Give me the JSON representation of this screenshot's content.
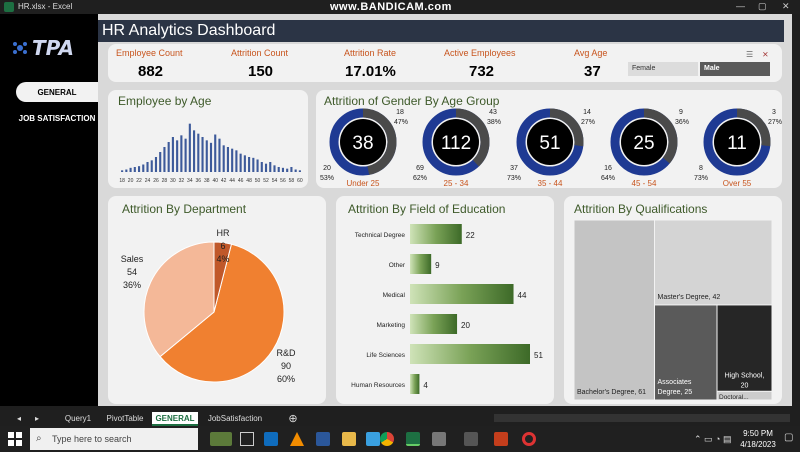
{
  "window": {
    "title": "HR.xlsx - Excel",
    "watermark": "www.BANDICAM.com"
  },
  "sidebar": {
    "logo": "TPA",
    "items": [
      {
        "label": "GENERAL"
      },
      {
        "label": "JOB SATISFACTION"
      }
    ]
  },
  "header": {
    "title": "HR Analytics Dashboard"
  },
  "kpis": [
    {
      "label": "Employee Count",
      "value": "882"
    },
    {
      "label": "Attrition Count",
      "value": "150"
    },
    {
      "label": "Attrition Rate",
      "value": "17.01%"
    },
    {
      "label": "Active Employees",
      "value": "732"
    },
    {
      "label": "Avg Age",
      "value": "37"
    }
  ],
  "gender_slicer": {
    "options": [
      "Female",
      "Male"
    ],
    "selected": "Male"
  },
  "charts": {
    "age_title": "Employee by Age",
    "gender_title": "Attrition of Gender By Age Group",
    "dept_title": "Attrition By Department",
    "edu_title": "Attrition By Field of Education",
    "qual_title": "Attrition By Qualifications"
  },
  "chart_data": [
    {
      "type": "bar",
      "title": "Employee by Age",
      "tick_labels": [
        "18",
        "20",
        "22",
        "24",
        "26",
        "28",
        "30",
        "32",
        "34",
        "36",
        "38",
        "40",
        "42",
        "44",
        "46",
        "48",
        "50",
        "52",
        "54",
        "56",
        "58",
        "60"
      ],
      "categories": [
        18,
        19,
        20,
        21,
        22,
        23,
        24,
        25,
        26,
        27,
        28,
        29,
        30,
        31,
        32,
        33,
        34,
        35,
        36,
        37,
        38,
        39,
        40,
        41,
        42,
        43,
        44,
        45,
        46,
        47,
        48,
        49,
        50,
        51,
        52,
        53,
        54,
        55,
        56,
        57,
        58,
        59,
        60
      ],
      "values": [
        2,
        3,
        5,
        6,
        7,
        9,
        12,
        14,
        18,
        24,
        30,
        36,
        42,
        38,
        44,
        40,
        58,
        50,
        46,
        42,
        38,
        35,
        45,
        40,
        32,
        30,
        28,
        26,
        22,
        20,
        18,
        17,
        15,
        12,
        10,
        12,
        8,
        6,
        5,
        4,
        6,
        3,
        2
      ],
      "ylim": [
        0,
        60
      ]
    },
    {
      "type": "pie",
      "title": "Attrition of Gender By Age Group",
      "groups": [
        {
          "label": "Under 25",
          "total": "38",
          "female_count": "18",
          "female_pct": "47%",
          "male_count": "20",
          "male_pct": "53%",
          "female_share": 0.47
        },
        {
          "label": "25 - 34",
          "total": "112",
          "female_count": "43",
          "female_pct": "38%",
          "male_count": "69",
          "male_pct": "62%",
          "female_share": 0.38
        },
        {
          "label": "35 - 44",
          "total": "51",
          "female_count": "14",
          "female_pct": "27%",
          "male_count": "37",
          "male_pct": "73%",
          "female_share": 0.27
        },
        {
          "label": "45 - 54",
          "total": "25",
          "female_count": "9",
          "female_pct": "36%",
          "male_count": "16",
          "male_pct": "64%",
          "female_share": 0.36
        },
        {
          "label": "Over 55",
          "total": "11",
          "female_count": "3",
          "female_pct": "27%",
          "male_count": "8",
          "male_pct": "73%",
          "female_share": 0.27
        }
      ]
    },
    {
      "type": "pie",
      "title": "Attrition By Department",
      "slices": [
        {
          "name": "R&D",
          "value": 90,
          "pct": "60%",
          "color": "#f08030"
        },
        {
          "name": "Sales",
          "value": 54,
          "pct": "36%",
          "color": "#f4b898"
        },
        {
          "name": "HR",
          "value": 6,
          "pct": "4%",
          "color": "#c0582a"
        }
      ]
    },
    {
      "type": "bar",
      "title": "Attrition By Field of Education",
      "categories": [
        "Technical Degree",
        "Other",
        "Medical",
        "Marketing",
        "Life Sciences",
        "Human Resources"
      ],
      "values": [
        22,
        9,
        44,
        20,
        51,
        4
      ],
      "xlim": [
        0,
        51
      ]
    },
    {
      "type": "heatmap",
      "title": "Attrition By Qualifications",
      "items": [
        {
          "name": "Bachelor's Degree",
          "value": 61,
          "label": "Bachelor's Degree, 61",
          "color": "#c4c4c4"
        },
        {
          "name": "Master's Degree",
          "value": 42,
          "label": "Master's Degree, 42",
          "color": "#d4d4d4"
        },
        {
          "name": "Associates Degree",
          "value": 25,
          "label": "Associates Degree, 25",
          "color": "#5a5a5a"
        },
        {
          "name": "High School",
          "value": 20,
          "label": "High School, 20",
          "color": "#262626"
        },
        {
          "name": "Doctoral",
          "value": 2,
          "label": "Doctoral...",
          "color": "#cccccc"
        }
      ]
    }
  ],
  "tabs": [
    "Query1",
    "PivotTable",
    "GENERAL",
    "JobSatisfaction"
  ],
  "active_tab": "GENERAL",
  "taskbar": {
    "search_placeholder": "Type here to search",
    "time": "9:50 PM",
    "date": "4/18/2023"
  }
}
